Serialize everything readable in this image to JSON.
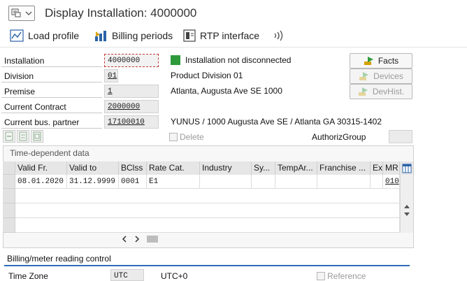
{
  "window": {
    "title": "Display Installation: 4000000"
  },
  "toolbar": {
    "load_profile": "Load profile",
    "billing_periods": "Billing periods",
    "rtp_interface": "RTP interface"
  },
  "form": {
    "installation": {
      "label": "Installation",
      "value": "4000000",
      "status_text": "Installation not disconnected",
      "status_color": "#2e9a3a"
    },
    "division": {
      "label": "Division",
      "value": "01",
      "text": "Product Division 01"
    },
    "premise": {
      "label": "Premise",
      "value": "1",
      "text": "Atlanta, Augusta Ave SE 1000"
    },
    "contract": {
      "label": "Current Contract",
      "value": "2000000"
    },
    "bus_partner": {
      "label": "Current bus. partner",
      "value": "17100010",
      "text": "YUNUS / 1000 Augusta Ave SE / Atlanta GA 30315-1402"
    },
    "delete_label": "Delete",
    "authoriz_label": "AuthorizGroup"
  },
  "buttons": {
    "facts": "Facts",
    "devices": "Devices",
    "devhist": "DevHist."
  },
  "table": {
    "title": "Time-dependent data",
    "columns": [
      "Valid Fr.",
      "Valid to",
      "BClss",
      "Rate Cat.",
      "Industry",
      "Sy...",
      "TempAr...",
      "Franchise ...",
      "Ex",
      "MR"
    ],
    "rows": [
      [
        "08.01.2020",
        "31.12.9999",
        "0001",
        "E1",
        "",
        "",
        "",
        "",
        "",
        "010"
      ]
    ]
  },
  "billing": {
    "section_title": "Billing/meter reading control",
    "time_zone_label": "Time Zone",
    "time_zone_value": "UTC",
    "time_zone_text": "UTC+0",
    "reference_label": "Reference"
  }
}
